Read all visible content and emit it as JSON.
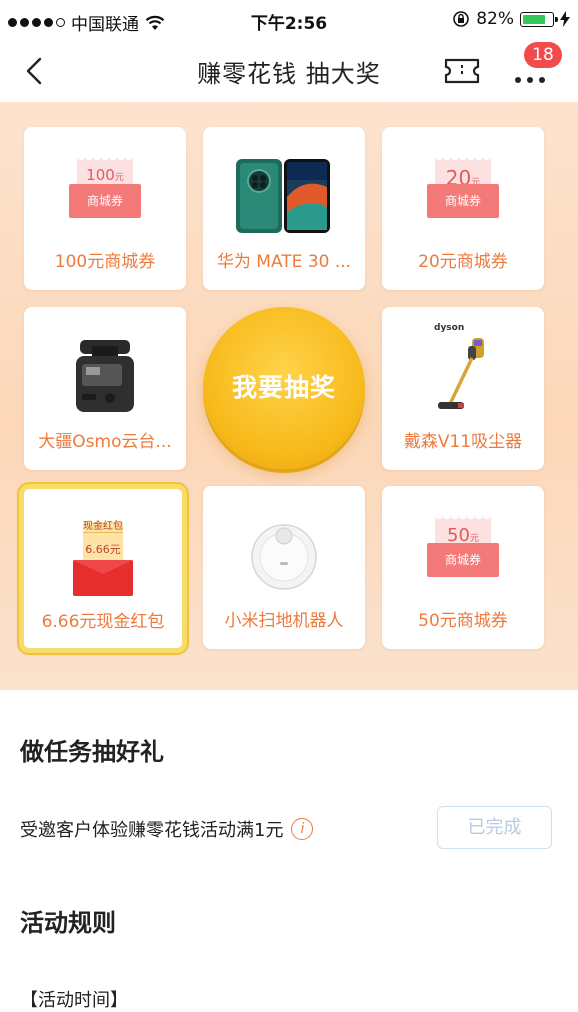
{
  "status_bar": {
    "carrier": "中国联通",
    "time": "下午2:56",
    "battery_percent": "82%",
    "battery_level": 0.82
  },
  "nav": {
    "title": "赚零花钱 抽大奖",
    "badge_count": "18"
  },
  "prizes": [
    {
      "label": "100元商城券",
      "type": "coupon",
      "value": "100",
      "unit": "元",
      "coupon_text": "商城券"
    },
    {
      "label": "华为 MATE 30 ...",
      "type": "phone"
    },
    {
      "label": "20元商城券",
      "type": "coupon",
      "value": "20",
      "unit": "元",
      "coupon_text": "商城券"
    },
    {
      "label": "大疆Osmo云台...",
      "type": "camera"
    },
    {
      "label": "戴森V11吸尘器",
      "type": "vacuum",
      "brand_text": "dyson"
    },
    {
      "label": "6.66元现金红包",
      "type": "red_packet",
      "header": "现金红包",
      "value": "6.66元",
      "selected": true
    },
    {
      "label": "小米扫地机器人",
      "type": "robot"
    },
    {
      "label": "50元商城券",
      "type": "coupon",
      "value": "50",
      "unit": "元",
      "coupon_text": "商城券"
    }
  ],
  "draw_button": {
    "label": "我要抽奖"
  },
  "tasks": {
    "title": "做任务抽好礼",
    "items": [
      {
        "text": "受邀客户体验赚零花钱活动满1元",
        "status": "已完成"
      }
    ]
  },
  "rules": {
    "title": "活动规则",
    "subtitle": "【活动时间】"
  },
  "colors": {
    "accent_orange": "#ee7a3c",
    "gold": "#f7b91a",
    "badge_red": "#f24b4b"
  }
}
